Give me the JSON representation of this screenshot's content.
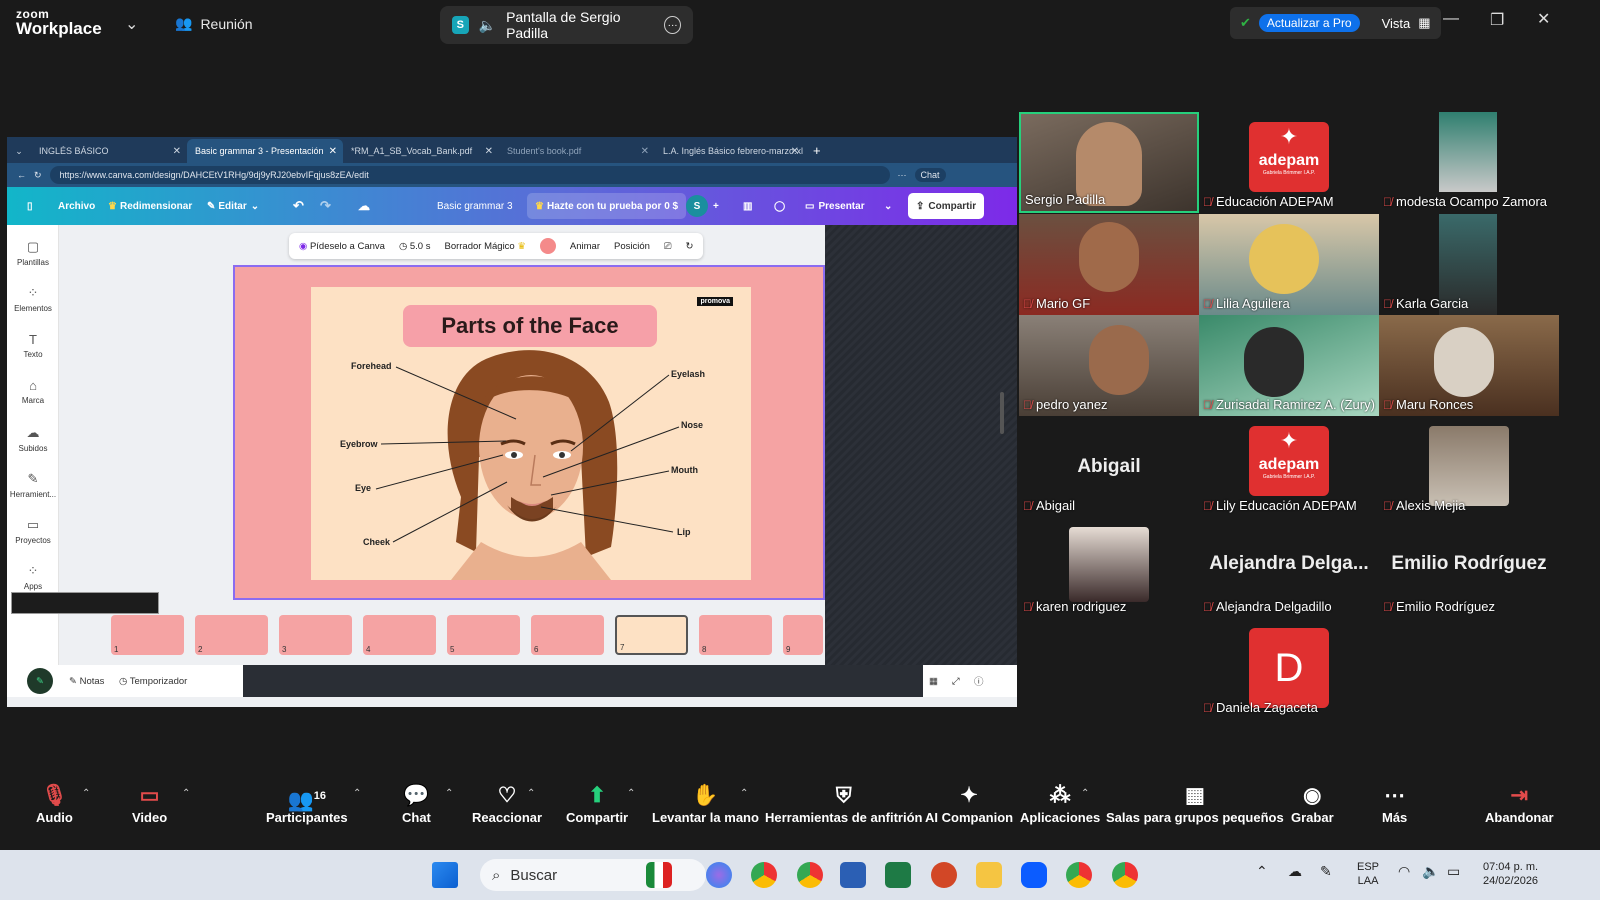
{
  "zoom": {
    "brand_top": "zoom",
    "brand_bottom": "Workplace",
    "meeting_label": "Reunión",
    "share_label": "Pantalla de Sergio Padilla",
    "share_badge": "S",
    "upgrade_label": "Actualizar a Pro",
    "view_label": "Vista"
  },
  "browser": {
    "tabs": [
      {
        "label": "INGLÉS BÁSICO"
      },
      {
        "label": "Basic grammar 3 - Presentación"
      },
      {
        "label": "*RM_A1_SB_Vocab_Bank.pdf"
      },
      {
        "label": "Student's book.pdf"
      },
      {
        "label": "L.A. Inglés Básico febrero-marzo.xl"
      }
    ],
    "url": "https://www.canva.com/design/DAHCEtV1RHg/9dj9yRJ20ebvIFqjus8zEA/edit",
    "chat_label": "Chat"
  },
  "canva": {
    "archivo": "Archivo",
    "redimensionar": "Redimensionar",
    "editar": "Editar",
    "doc_title": "Basic grammar 3",
    "trial": "Hazte con tu prueba por 0 $",
    "avatar": "S",
    "presentar": "Presentar",
    "compartir": "Compartir",
    "rail": [
      "Plantillas",
      "Elementos",
      "Texto",
      "Marca",
      "Subidos",
      "Herramient...",
      "Proyectos",
      "Apps"
    ],
    "tools": {
      "ask": "Pídeselo a Canva",
      "duration": "5.0 s",
      "eraser": "Borrador Mágico",
      "animate": "Animar",
      "position": "Posición"
    },
    "slide": {
      "title": "Parts of the Face",
      "brand": "promova",
      "labels": {
        "forehead": "Forehead",
        "eyebrow": "Eyebrow",
        "eye": "Eye",
        "cheek": "Cheek",
        "eyelash": "Eyelash",
        "nose": "Nose",
        "mouth": "Mouth",
        "lip": "Lip"
      }
    },
    "thumbs": [
      "1",
      "2",
      "3",
      "4",
      "5",
      "6",
      "7",
      "8",
      "9"
    ],
    "notes": "Notas",
    "timer": "Temporizador"
  },
  "participants": [
    {
      "name": "Sergio Padilla"
    },
    {
      "name": "Educación ADEPAM"
    },
    {
      "name": "modesta Ocampo Zamora"
    },
    {
      "name": "Mario GF"
    },
    {
      "name": "Lilia Aguilera"
    },
    {
      "name": "Karla Garcia"
    },
    {
      "name": "pedro yanez"
    },
    {
      "name": "Zurisadai Ramirez A. (Zury)"
    },
    {
      "name": "Maru Ronces"
    },
    {
      "name": "Abigail",
      "big": "Abigail"
    },
    {
      "name": "Lily Educación ADEPAM"
    },
    {
      "name": "Alexis Mejia"
    },
    {
      "name": "karen rodriguez"
    },
    {
      "name": "Alejandra Delgadillo",
      "big": "Alejandra  Delga..."
    },
    {
      "name": "Emilio Rodríguez",
      "big": "Emilio Rodríguez"
    },
    {
      "name": "Daniela Zagaceta",
      "initial": "D"
    }
  ],
  "adepam": {
    "word": "adepam",
    "sub": "Gabriela Brimmer I.A.P."
  },
  "toolbar": {
    "audio": "Audio",
    "video": "Video",
    "participants": "Participantes",
    "participants_count": "16",
    "chat": "Chat",
    "react": "Reaccionar",
    "share": "Compartir",
    "hand": "Levantar la mano",
    "host": "Herramientas de anfitrión",
    "ai": "AI Companion",
    "apps": "Aplicaciones",
    "rooms": "Salas para grupos pequeños",
    "record": "Grabar",
    "more": "Más",
    "leave": "Abandonar"
  },
  "taskbar": {
    "search": "Buscar",
    "lang1": "ESP",
    "lang2": "LAA",
    "time": "07:04 p. m.",
    "date": "24/02/2026"
  }
}
